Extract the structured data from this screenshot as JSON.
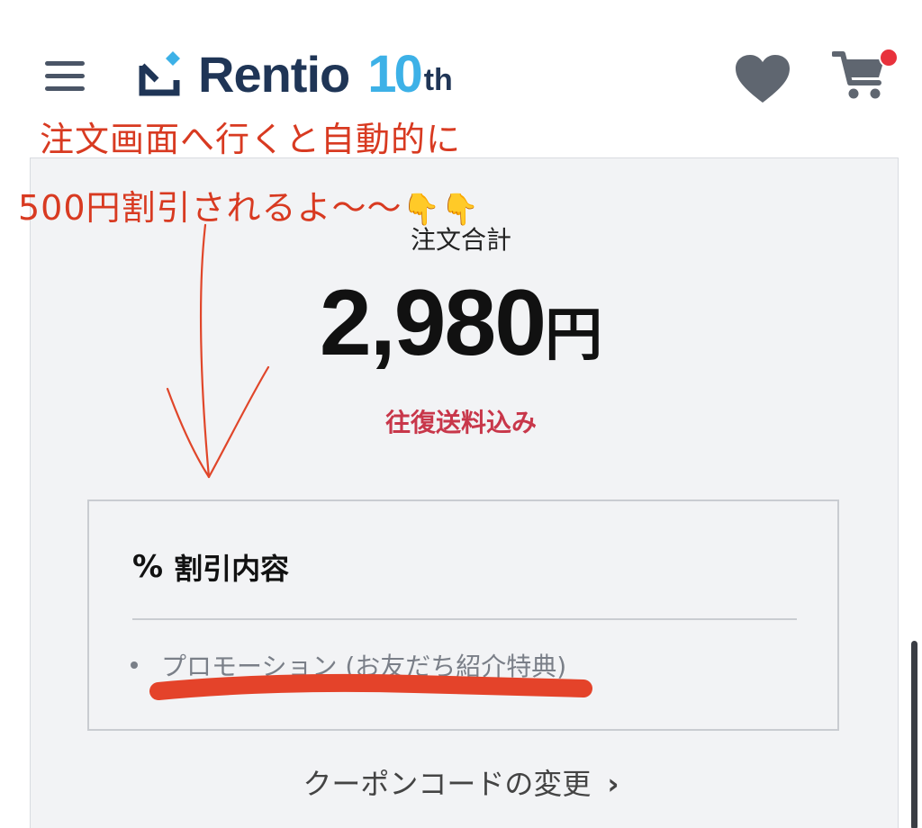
{
  "header": {
    "brand_name": "Rentio",
    "brand_anniversary_num": "10",
    "brand_anniversary_suffix": "th",
    "menu_icon": "hamburger-icon",
    "favorites_icon": "heart-icon",
    "cart_icon": "cart-icon",
    "colors": {
      "brand_navy": "#1f3556",
      "brand_blue": "#3db1e7",
      "badge_red": "#e8323c"
    }
  },
  "annotation": {
    "line1": "注文画面へ行くと自動的に",
    "line2": "500円割引されるよ〜〜",
    "emoji": "👇👇",
    "color": "#d83a21"
  },
  "order": {
    "total_label": "注文合計",
    "total_amount": "2,980",
    "currency": "円",
    "shipping_note": "往復送料込み"
  },
  "discount": {
    "icon": "percent-icon",
    "title": "割引内容",
    "items": [
      {
        "label": "プロモーション (お友だち紹介特典)"
      }
    ]
  },
  "coupon": {
    "link_label": "クーポンコードの変更",
    "chevron": "›"
  }
}
